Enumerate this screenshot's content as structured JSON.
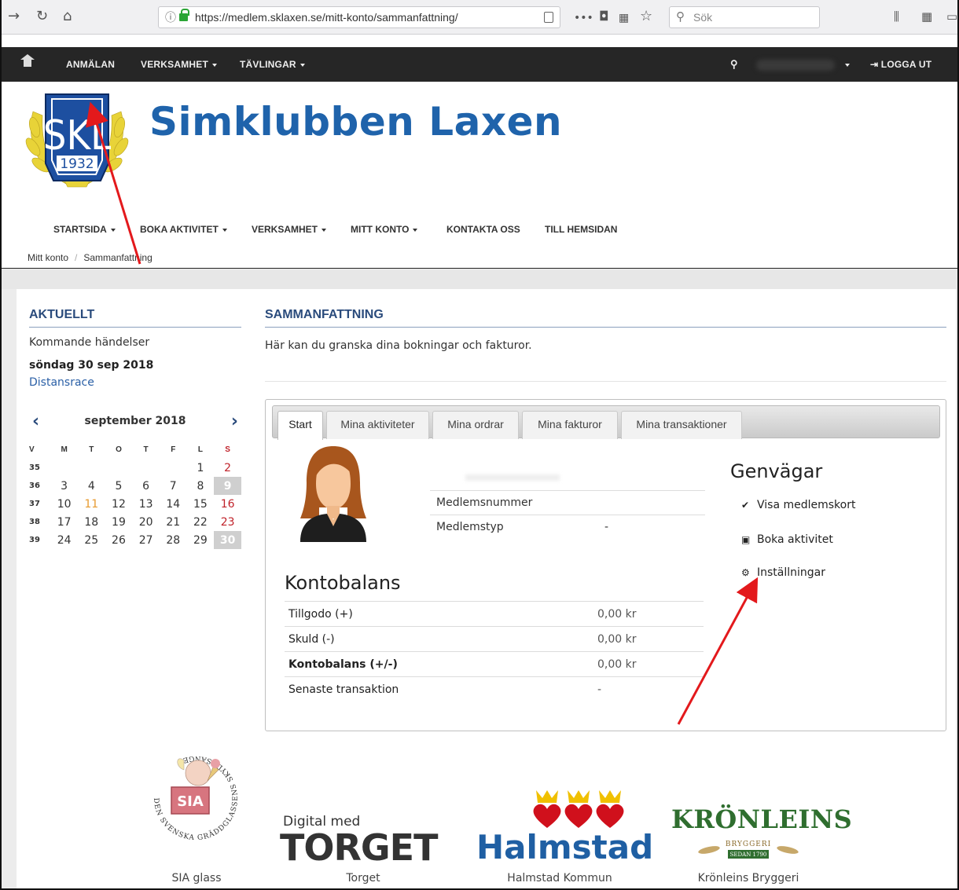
{
  "browser": {
    "url": "https://medlem.sklaxen.se/mitt-konto/sammanfattning/",
    "search_placeholder": "Sök"
  },
  "top_nav": {
    "items": [
      "ANMÄLAN",
      "VERKSAMHET",
      "TÄVLINGAR"
    ],
    "logout": "LOGGA UT"
  },
  "header": {
    "title": "Simklubben Laxen",
    "logo_letters": "SKL",
    "logo_year": "1932"
  },
  "main_nav": {
    "items": [
      "STARTSIDA",
      "BOKA AKTIVITET",
      "VERKSAMHET",
      "MITT KONTO",
      "KONTAKTA OSS",
      "TILL HEMSIDAN"
    ]
  },
  "breadcrumb": {
    "items": [
      "Mitt konto",
      "Sammanfattning"
    ]
  },
  "sidebar": {
    "heading": "AKTUELLT",
    "upcoming_label": "Kommande händelser",
    "event_date": "söndag 30 sep 2018",
    "event_name": "Distansrace",
    "calendar": {
      "month": "september 2018",
      "prev": "‹",
      "next": "›",
      "weekdays": [
        "V",
        "M",
        "T",
        "O",
        "T",
        "F",
        "L",
        "S"
      ],
      "weeks": [
        {
          "wk": "35",
          "days": [
            "",
            "",
            "",
            "",
            "",
            "1",
            "2"
          ]
        },
        {
          "wk": "36",
          "days": [
            "3",
            "4",
            "5",
            "6",
            "7",
            "8",
            "9"
          ]
        },
        {
          "wk": "37",
          "days": [
            "10",
            "11",
            "12",
            "13",
            "14",
            "15",
            "16"
          ]
        },
        {
          "wk": "38",
          "days": [
            "17",
            "18",
            "19",
            "20",
            "21",
            "22",
            "23"
          ]
        },
        {
          "wk": "39",
          "days": [
            "24",
            "25",
            "26",
            "27",
            "28",
            "29",
            "30"
          ]
        }
      ]
    }
  },
  "main": {
    "heading": "SAMMANFATTNING",
    "intro": "Här kan du granska dina bokningar och fakturor.",
    "tabs": [
      "Start",
      "Mina aktiviteter",
      "Mina ordrar",
      "Mina fakturor",
      "Mina transaktioner"
    ],
    "member": {
      "number_label": "Medlemsnummer",
      "type_label": "Medlemstyp",
      "type_value": "-"
    },
    "balance": {
      "title": "Kontobalans",
      "rows": [
        {
          "label": "Tillgodo (+)",
          "value": "0,00 kr"
        },
        {
          "label": "Skuld (-)",
          "value": "0,00 kr"
        },
        {
          "label": "Kontobalans (+/-)",
          "value": "0,00 kr"
        },
        {
          "label": "Senaste transaktion",
          "value": "-"
        }
      ]
    },
    "shortcuts": {
      "title": "Genvägar",
      "items": [
        "Visa medlemskort",
        "Boka aktivitet",
        "Inställningar"
      ]
    }
  },
  "sponsors": {
    "sia_logo_text": "SIA",
    "sia_ring_text": "DEN SVENSKA GRÄDDGLASSENS SKYDDSÄNGEL",
    "sia_label": "SIA glass",
    "torget_pre": "Digital med",
    "torget_logo": "TORGET",
    "torget_label": "Torget",
    "halmstad_logo": "Halmstad",
    "halmstad_label": "Halmstad Kommun",
    "kronleins_logo": "KRÖNLEINS",
    "kronleins_sub": "BRYGGERI",
    "kronleins_since": "SEDAN 1790",
    "kronleins_label": "Krönleins Bryggeri"
  },
  "colors": {
    "brand_blue": "#1f63ab",
    "nav_dark": "#262626",
    "heading_blue": "#2a4b7c",
    "calendar_red": "#c0222a",
    "calendar_today": "#e79a2f",
    "annotation_arrow": "#e3191c"
  }
}
